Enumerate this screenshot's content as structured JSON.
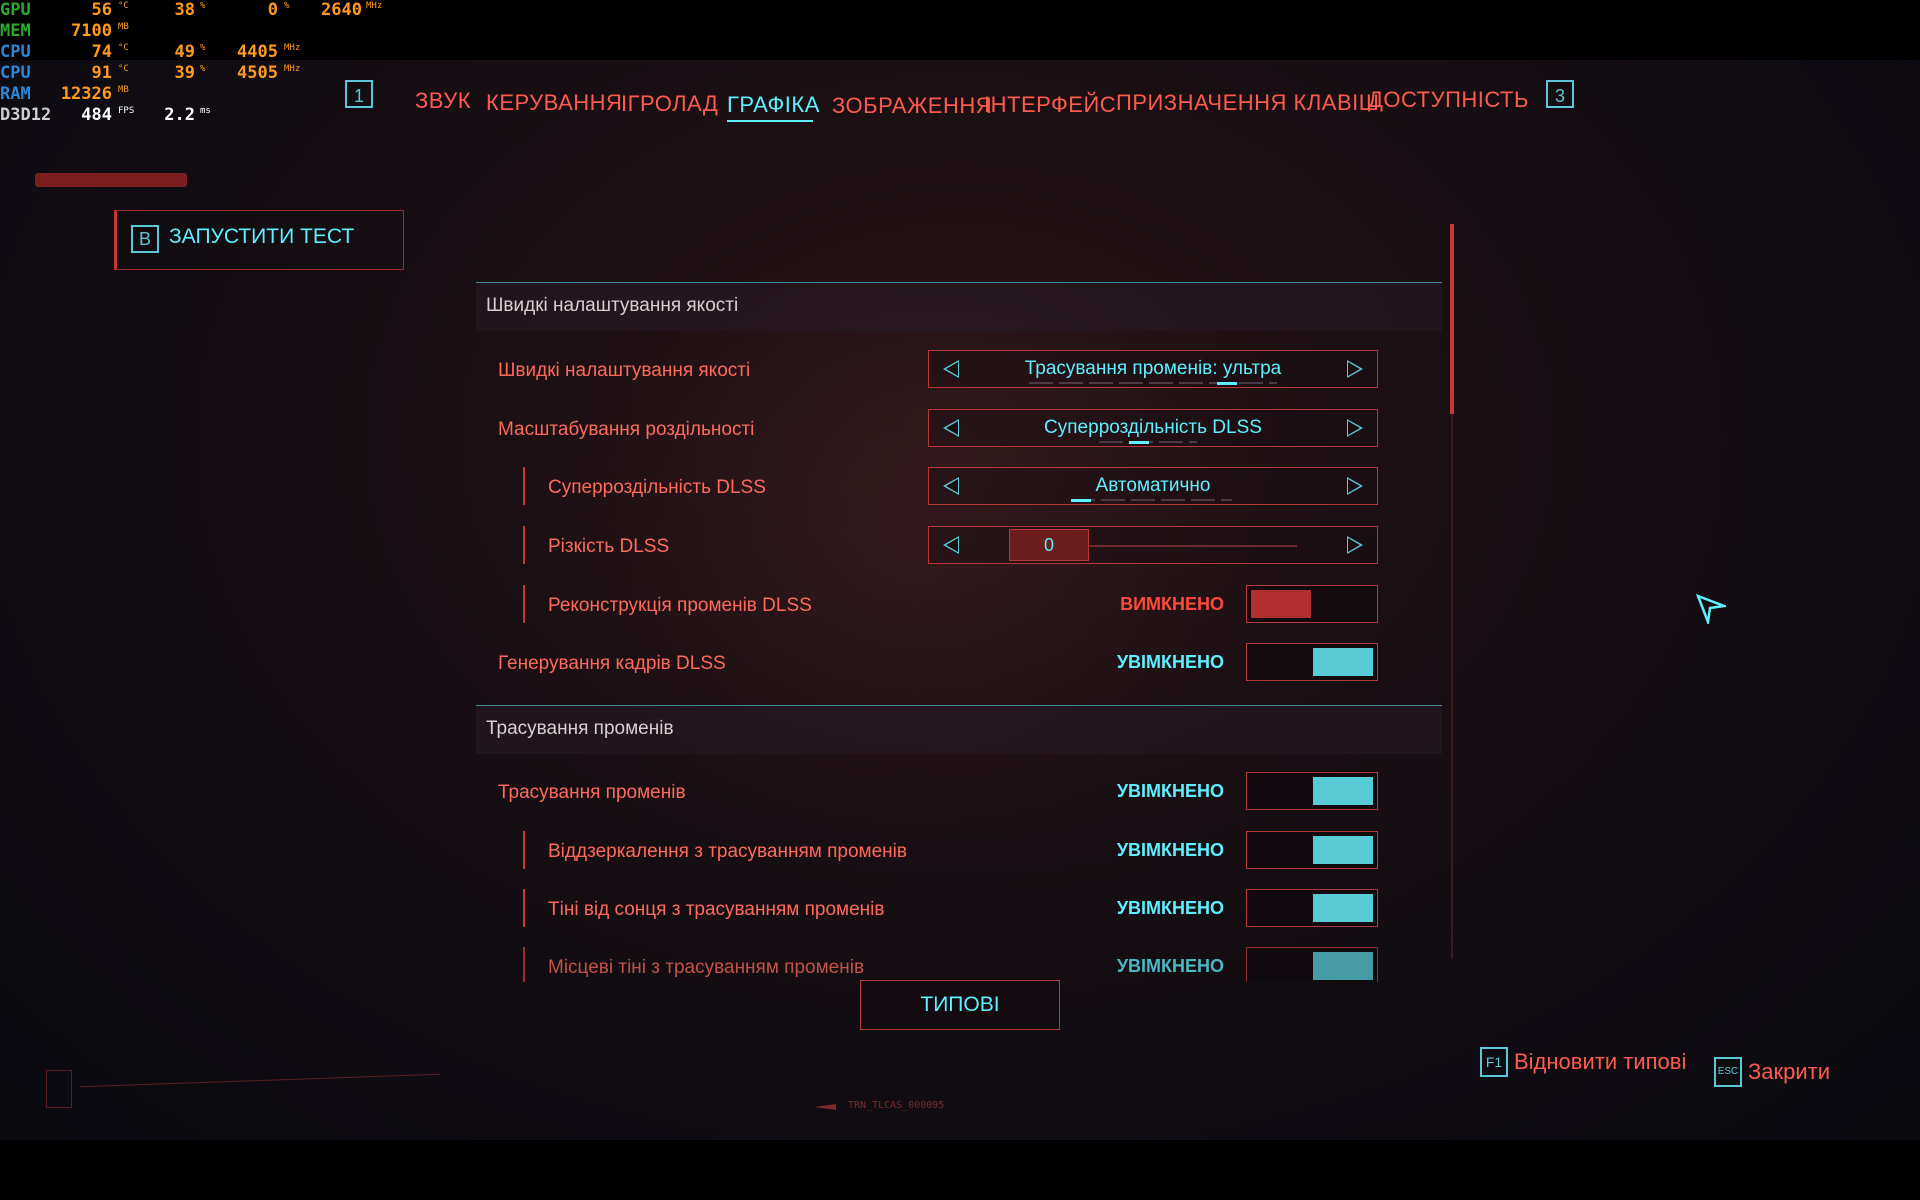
{
  "overlay": {
    "gpu": {
      "label": "GPU",
      "temp": "56",
      "temp_unit": "°C",
      "load": "38",
      "load_unit": "%",
      "extra": "0",
      "extra_unit": "%",
      "clock": "2640",
      "clock_unit": "MHz"
    },
    "mem": {
      "label": "MEM",
      "value": "7100",
      "unit": "MB"
    },
    "cpu1": {
      "label": "CPU",
      "temp": "74",
      "temp_unit": "°C",
      "load": "49",
      "load_unit": "%",
      "clock": "4405",
      "clock_unit": "MHz"
    },
    "cpu2": {
      "label": "CPU",
      "temp": "91",
      "temp_unit": "°C",
      "load": "39",
      "load_unit": "%",
      "clock": "4505",
      "clock_unit": "MHz"
    },
    "ram": {
      "label": "RAM",
      "value": "12326",
      "unit": "MB"
    },
    "d3d": {
      "label": "D3D12",
      "fps": "484",
      "fps_unit": "FPS",
      "frametime": "2.2",
      "frametime_unit": "ms"
    }
  },
  "tabs": {
    "left_bumper": "1",
    "right_bumper": "3",
    "items": [
      "ЗВУК",
      "КЕРУВАННЯ",
      "ІГРОЛАД",
      "ГРАФІКА",
      "ЗОБРАЖЕННЯ",
      "ІНТЕРФЕЙС",
      "ПРИЗНАЧЕННЯ КЛАВІШ",
      "ДОСТУПНІСТЬ"
    ],
    "active_index": 3
  },
  "benchmark": {
    "key": "B",
    "label": "ЗАПУСТИТИ ТЕСТ"
  },
  "sections": {
    "quick": {
      "title": "Швидкі налаштування якості",
      "quick_preset": {
        "label": "Швидкі налаштування якості",
        "value": "Трасування променів: ультра"
      },
      "resolution_scaling": {
        "label": "Масштабування роздільності",
        "value": "Суперроздільність DLSS"
      },
      "dlss_sr": {
        "label": "Суперроздільність DLSS",
        "value": "Автоматично"
      },
      "dlss_sharpness": {
        "label": "Різкість DLSS",
        "value": "0"
      },
      "dlss_rr": {
        "label": "Реконструкція променів DLSS",
        "state": "ВИМКНЕНО"
      },
      "dlss_fg": {
        "label": "Генерування кадрів DLSS",
        "state": "УВІМКНЕНО"
      }
    },
    "rt": {
      "title": "Трасування променів",
      "ray_tracing": {
        "label": "Трасування променів",
        "state": "УВІМКНЕНО"
      },
      "rt_reflections": {
        "label": "Віддзеркалення з трасуванням променів",
        "state": "УВІМКНЕНО"
      },
      "rt_sun_shadows": {
        "label": "Тіні від сонця з трасуванням променів",
        "state": "УВІМКНЕНО"
      },
      "rt_local_shadows": {
        "label": "Місцеві тіні з трасуванням променів",
        "state": "УВІМКНЕНО"
      }
    }
  },
  "buttons": {
    "defaults": "ТИПОВІ"
  },
  "hints": {
    "restore_key": "F1",
    "restore_label": "Відновити типові",
    "close_key": "ESC",
    "close_label": "Закрити"
  },
  "build_id": "TRN_TLCAS_000095",
  "colors": {
    "accent_cyan": "#5ef0ff",
    "accent_red": "#ff5a4e",
    "toggle_on": "#57ccd6",
    "toggle_off": "#b1302d"
  }
}
